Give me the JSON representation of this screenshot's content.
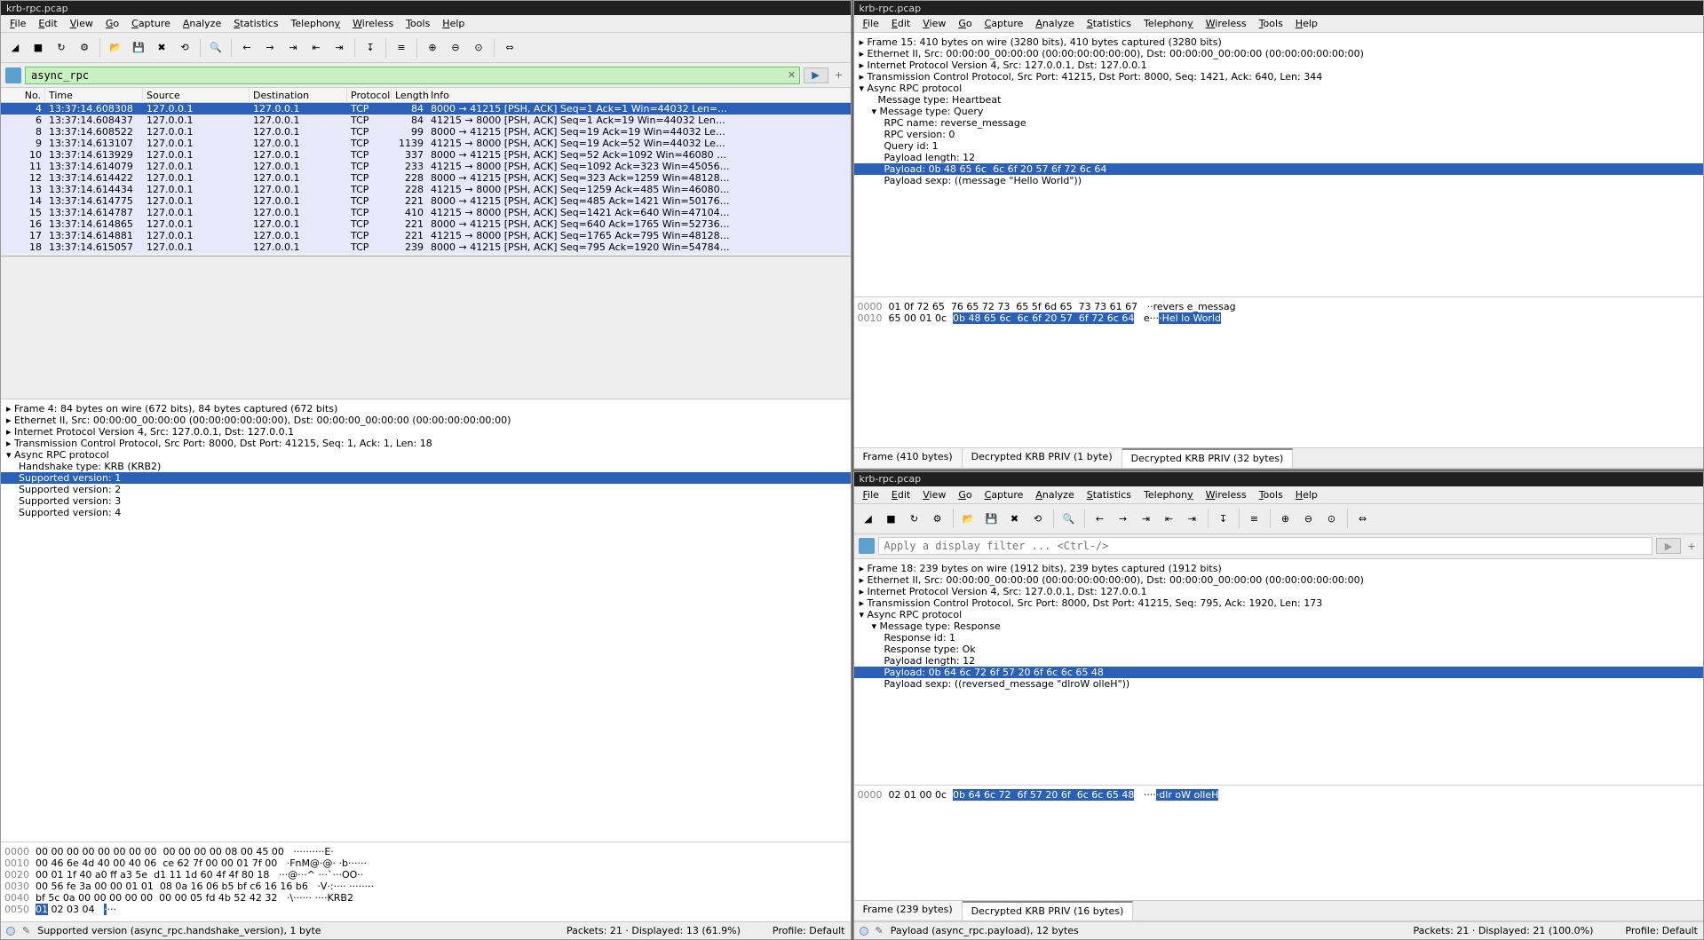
{
  "titles": {
    "tl": "krb-rpc.pcap",
    "tr": "krb-rpc.pcap",
    "br": "krb-rpc.pcap"
  },
  "menu": [
    "File",
    "Edit",
    "View",
    "Go",
    "Capture",
    "Analyze",
    "Statistics",
    "Telephony",
    "Wireless",
    "Tools",
    "Help"
  ],
  "filter_tl": "async_rpc",
  "filter_br_placeholder": "Apply a display filter ... <Ctrl-/>",
  "columns": [
    "No.",
    "Time",
    "Source",
    "Destination",
    "Protocol",
    "Length",
    "Info"
  ],
  "packets": [
    {
      "no": 4,
      "time": "13:37:14.608308",
      "src": "127.0.0.1",
      "dst": "127.0.0.1",
      "proto": "TCP",
      "len": 84,
      "info": "8000 → 41215 [PSH, ACK] Seq=1 Ack=1 Win=44032 Len=…",
      "sel": true
    },
    {
      "no": 6,
      "time": "13:37:14.608437",
      "src": "127.0.0.1",
      "dst": "127.0.0.1",
      "proto": "TCP",
      "len": 84,
      "info": "41215 → 8000 [PSH, ACK] Seq=1 Ack=19 Win=44032 Len…"
    },
    {
      "no": 8,
      "time": "13:37:14.608522",
      "src": "127.0.0.1",
      "dst": "127.0.0.1",
      "proto": "TCP",
      "len": 99,
      "info": "8000 → 41215 [PSH, ACK] Seq=19 Ack=19 Win=44032 Le…"
    },
    {
      "no": 9,
      "time": "13:37:14.613107",
      "src": "127.0.0.1",
      "dst": "127.0.0.1",
      "proto": "TCP",
      "len": 1139,
      "info": "41215 → 8000 [PSH, ACK] Seq=19 Ack=52 Win=44032 Le…"
    },
    {
      "no": 10,
      "time": "13:37:14.613929",
      "src": "127.0.0.1",
      "dst": "127.0.0.1",
      "proto": "TCP",
      "len": 337,
      "info": "8000 → 41215 [PSH, ACK] Seq=52 Ack=1092 Win=46080 …"
    },
    {
      "no": 11,
      "time": "13:37:14.614079",
      "src": "127.0.0.1",
      "dst": "127.0.0.1",
      "proto": "TCP",
      "len": 233,
      "info": "41215 → 8000 [PSH, ACK] Seq=1092 Ack=323 Win=45056…"
    },
    {
      "no": 12,
      "time": "13:37:14.614422",
      "src": "127.0.0.1",
      "dst": "127.0.0.1",
      "proto": "TCP",
      "len": 228,
      "info": "8000 → 41215 [PSH, ACK] Seq=323 Ack=1259 Win=48128…"
    },
    {
      "no": 13,
      "time": "13:37:14.614434",
      "src": "127.0.0.1",
      "dst": "127.0.0.1",
      "proto": "TCP",
      "len": 228,
      "info": "41215 → 8000 [PSH, ACK] Seq=1259 Ack=485 Win=46080…"
    },
    {
      "no": 14,
      "time": "13:37:14.614775",
      "src": "127.0.0.1",
      "dst": "127.0.0.1",
      "proto": "TCP",
      "len": 221,
      "info": "8000 → 41215 [PSH, ACK] Seq=485 Ack=1421 Win=50176…"
    },
    {
      "no": 15,
      "time": "13:37:14.614787",
      "src": "127.0.0.1",
      "dst": "127.0.0.1",
      "proto": "TCP",
      "len": 410,
      "info": "41215 → 8000 [PSH, ACK] Seq=1421 Ack=640 Win=47104…"
    },
    {
      "no": 16,
      "time": "13:37:14.614865",
      "src": "127.0.0.1",
      "dst": "127.0.0.1",
      "proto": "TCP",
      "len": 221,
      "info": "8000 → 41215 [PSH, ACK] Seq=640 Ack=1765 Win=52736…"
    },
    {
      "no": 17,
      "time": "13:37:14.614881",
      "src": "127.0.0.1",
      "dst": "127.0.0.1",
      "proto": "TCP",
      "len": 221,
      "info": "41215 → 8000 [PSH, ACK] Seq=1765 Ack=795 Win=48128…"
    },
    {
      "no": 18,
      "time": "13:37:14.615057",
      "src": "127.0.0.1",
      "dst": "127.0.0.1",
      "proto": "TCP",
      "len": 239,
      "info": "8000 → 41215 [PSH, ACK] Seq=795 Ack=1920 Win=54784…"
    }
  ],
  "tree_tl": [
    {
      "t": "▸ Frame 4: 84 bytes on wire (672 bits), 84 bytes captured (672 bits)"
    },
    {
      "t": "▸ Ethernet II, Src: 00:00:00_00:00:00 (00:00:00:00:00:00), Dst: 00:00:00_00:00:00 (00:00:00:00:00:00)"
    },
    {
      "t": "▸ Internet Protocol Version 4, Src: 127.0.0.1, Dst: 127.0.0.1"
    },
    {
      "t": "▸ Transmission Control Protocol, Src Port: 8000, Dst Port: 41215, Seq: 1, Ack: 1, Len: 18"
    },
    {
      "t": "▾ Async RPC protocol"
    },
    {
      "t": "    Handshake type: KRB (KRB2)"
    },
    {
      "t": "    Supported version: 1",
      "sel": true
    },
    {
      "t": "    Supported version: 2"
    },
    {
      "t": "    Supported version: 3"
    },
    {
      "t": "    Supported version: 4"
    }
  ],
  "hex_tl": [
    {
      "off": "0000",
      "h": "00 00 00 00 00 00 00 00  00 00 00 00 08 00 45 00",
      "a": "··········E·"
    },
    {
      "off": "0010",
      "h": "00 46 6e 4d 40 00 40 06  ce 62 7f 00 00 01 7f 00",
      "a": "·FnM@·@· ·b······"
    },
    {
      "off": "0020",
      "h": "00 01 1f 40 a0 ff a3 5e  d1 11 1d 60 4f 4f 80 18",
      "a": "···@···^ ···`···OO··"
    },
    {
      "off": "0030",
      "h": "00 56 fe 3a 00 00 01 01  08 0a 16 06 b5 bf c6 16 16 b6",
      "a": "·V·:···· ········"
    },
    {
      "off": "0040",
      "h": "bf 5c 0a 00 00 00 00 00  00 00 05 fd 4b 52 42 32",
      "a": "·\\······ ····KRB2"
    },
    {
      "off": "0050",
      "h": "01 02 03 04",
      "a": "····",
      "hi_start": 0,
      "hi_len": 2
    }
  ],
  "status_tl_desc": "Supported version (async_rpc.handshake_version), 1 byte",
  "status_tl_pk": "Packets: 21 · Displayed: 13 (61.9%)",
  "status_tl_prof": "Profile: Default",
  "tree_tr": [
    {
      "t": "▸ Frame 15: 410 bytes on wire (3280 bits), 410 bytes captured (3280 bits)"
    },
    {
      "t": "▸ Ethernet II, Src: 00:00:00_00:00:00 (00:00:00:00:00:00), Dst: 00:00:00_00:00:00 (00:00:00:00:00:00)"
    },
    {
      "t": "▸ Internet Protocol Version 4, Src: 127.0.0.1, Dst: 127.0.0.1"
    },
    {
      "t": "▸ Transmission Control Protocol, Src Port: 41215, Dst Port: 8000, Seq: 1421, Ack: 640, Len: 344"
    },
    {
      "t": "▾ Async RPC protocol"
    },
    {
      "t": "      Message type: Heartbeat"
    },
    {
      "t": "    ▾ Message type: Query"
    },
    {
      "t": "        RPC name: reverse_message"
    },
    {
      "t": "        RPC version: 0"
    },
    {
      "t": "        Query id: 1"
    },
    {
      "t": "        Payload length: 12"
    },
    {
      "t": "        Payload: 0b 48 65 6c  6c 6f 20 57 6f 72 6c 64",
      "sel": true
    },
    {
      "t": "        Payload sexp: ((message \"Hello World\"))"
    }
  ],
  "hex_tr": [
    {
      "off": "0000",
      "h": "01 0f 72 65  76 65 72 73  65 5f 6d 65  73 73 61 67",
      "a": "··revers e_messag"
    },
    {
      "off": "0010",
      "h": "65 00 01 0c  0b 48 65 6c  6c 6f 20 57  6f 72 6c 64",
      "a": "e····Hel lo World",
      "hi_h": "0b 48 65 6c  6c 6f 20 57  6f 72 6c 64",
      "hi_a": "·Hel lo World"
    }
  ],
  "tabs_tr": [
    "Frame (410 bytes)",
    "Decrypted KRB PRIV (1 byte)",
    "Decrypted KRB PRIV (32 bytes)"
  ],
  "tabs_tr_active": 2,
  "tree_br": [
    {
      "t": "▸ Frame 18: 239 bytes on wire (1912 bits), 239 bytes captured (1912 bits)"
    },
    {
      "t": "▸ Ethernet II, Src: 00:00:00_00:00:00 (00:00:00:00:00:00), Dst: 00:00:00_00:00:00 (00:00:00:00:00:00)"
    },
    {
      "t": "▸ Internet Protocol Version 4, Src: 127.0.0.1, Dst: 127.0.0.1"
    },
    {
      "t": "▸ Transmission Control Protocol, Src Port: 8000, Dst Port: 41215, Seq: 795, Ack: 1920, Len: 173"
    },
    {
      "t": "▾ Async RPC protocol"
    },
    {
      "t": "    ▾ Message type: Response"
    },
    {
      "t": "        Response id: 1"
    },
    {
      "t": "        Response type: Ok"
    },
    {
      "t": "        Payload length: 12"
    },
    {
      "t": "        Payload: 0b 64 6c 72 6f 57 20 6f 6c 6c 65 48",
      "sel": true
    },
    {
      "t": "        Payload sexp: ((reversed_message \"dlroW olleH\"))"
    }
  ],
  "hex_br": [
    {
      "off": "0000",
      "h": "02 01 00 0c  0b 64 6c 72  6f 57 20 6f  6c 6c 65 48",
      "a": "·····dlr oW olleH",
      "hi_h": "0b 64 6c 72  6f 57 20 6f  6c 6c 65 48",
      "hi_a": "·dlr oW olleH"
    }
  ],
  "tabs_br": [
    "Frame (239 bytes)",
    "Decrypted KRB PRIV (16 bytes)"
  ],
  "tabs_br_active": 1,
  "status_br_desc": "Payload (async_rpc.payload), 12 bytes",
  "status_br_pk": "Packets: 21 · Displayed: 21 (100.0%)",
  "status_br_prof": "Profile: Default",
  "toolbar_icons": [
    "shark-fin-icon",
    "stop-icon",
    "restart-icon",
    "options-icon",
    "sep",
    "open-icon",
    "save-icon",
    "close-file-icon",
    "reload-icon",
    "sep",
    "find-icon",
    "sep",
    "prev-icon",
    "next-icon",
    "jump-icon",
    "first-icon",
    "last-icon",
    "sep",
    "auto-scroll-icon",
    "sep",
    "colorize-icon",
    "sep",
    "zoom-in-icon",
    "zoom-out-icon",
    "zoom-reset-icon",
    "sep",
    "resize-columns-icon"
  ]
}
